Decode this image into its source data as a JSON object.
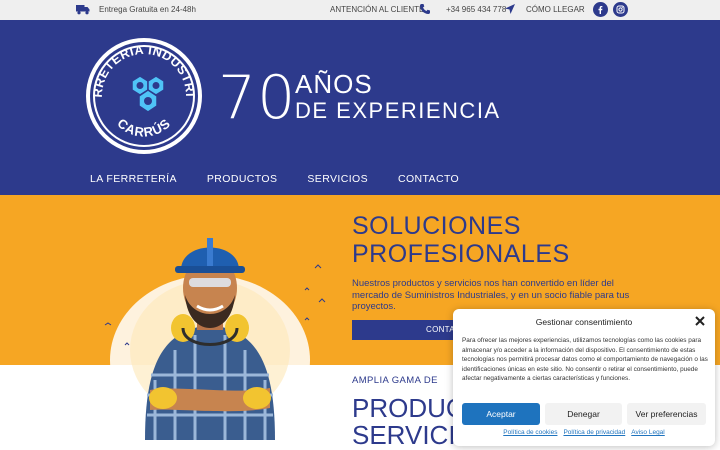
{
  "topbar": {
    "shipping": "Entrega Gratuita en 24-48h",
    "attention": "ANTENCIÓN AL CLIENTE",
    "phone": "+34 965 434 778",
    "directions": "CÓMO LLEGAR",
    "icons": [
      "truck-icon",
      "phone-icon",
      "location-arrow-icon",
      "facebook-icon",
      "instagram-icon"
    ]
  },
  "header": {
    "logo_text_top": "FERRETERIA INDUSTRIAL",
    "logo_text_bottom": "CARRÚS",
    "years": "70",
    "years_label": "AÑOS",
    "experience": "DE EXPERIENCIA",
    "nav": [
      "LA FERRETERÍA",
      "PRODUCTOS",
      "SERVICIOS",
      "CONTACTO"
    ]
  },
  "hero": {
    "title_line1": "SOLUCIONES",
    "title_line2": "PROFESIONALES",
    "text": "Nuestros productos y servicios nos han convertido en líder del mercado de Suministros Industriales, y en un socio fiable para tus proyectos.",
    "button": "CONTAC",
    "subheading": "AMPLIA GAMA DE",
    "big_line1": "PRODUCT",
    "big_line2": "SERVICIO"
  },
  "cookie": {
    "title": "Gestionar consentimiento",
    "description": "Para ofrecer las mejores experiencias, utilizamos tecnologías como las cookies para almacenar y/o acceder a la información del dispositivo. El consentimiento de estas tecnologías nos permitirá procesar datos como el comportamiento de navegación o las identificaciones únicas en este sitio. No consentir o retirar el consentimiento, puede afectar negativamente a ciertas características y funciones.",
    "accept": "Aceptar",
    "deny": "Denegar",
    "preferences": "Ver preferencias",
    "links": [
      "Política de cookies",
      "Política de privacidad",
      "Aviso Legal"
    ]
  },
  "colors": {
    "brand_blue": "#2d3a8c",
    "hero_orange": "#f6a623",
    "accept_blue": "#1e73be",
    "logo_cyan": "#4fc3f7"
  }
}
